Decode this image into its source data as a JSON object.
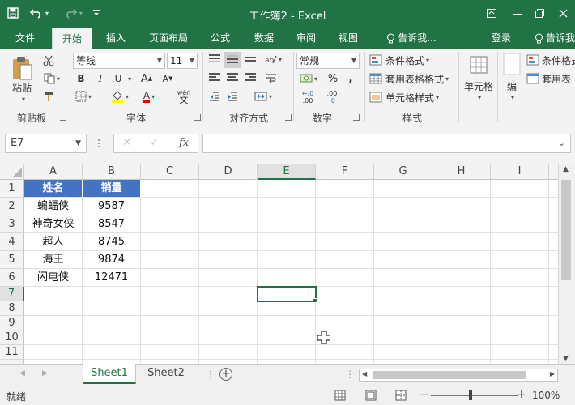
{
  "window": {
    "title": "工作簿2 - Excel"
  },
  "tabs": [
    {
      "label": "文件"
    },
    {
      "label": "开始"
    },
    {
      "label": "插入"
    },
    {
      "label": "页面布局"
    },
    {
      "label": "公式"
    },
    {
      "label": "数据"
    },
    {
      "label": "审阅"
    },
    {
      "label": "视图"
    },
    {
      "label": "告诉我..."
    },
    {
      "label": "登录"
    },
    {
      "label": "告诉我"
    }
  ],
  "ribbon": {
    "clipboard": {
      "paste": "粘贴",
      "group": "剪贴板"
    },
    "font": {
      "name": "等线",
      "size": "11",
      "group": "字体",
      "bold": "B",
      "italic": "I",
      "underline": "U",
      "grow": "A",
      "shrink": "A",
      "color_a": "A",
      "wen": "wén",
      "wen_char": "文"
    },
    "alignment": {
      "group": "对齐方式"
    },
    "number": {
      "format": "常规",
      "group": "数字",
      "percent": "%",
      "comma": ",",
      "inc_dec": ".00",
      "dec_dec": ".0"
    },
    "styles": {
      "conditional": "条件格式",
      "table": "套用表格格式",
      "cell_styles": "单元格样式",
      "group": "样式"
    },
    "cells": {
      "label": "单元格"
    },
    "editing": {
      "label": "编",
      "right1": "条件格式",
      "right2": "套用表"
    }
  },
  "formula_bar": {
    "name_box": "E7",
    "fx": "fx",
    "value": ""
  },
  "columns": [
    "A",
    "B",
    "C",
    "D",
    "E",
    "F",
    "G",
    "H",
    "I"
  ],
  "rows": [
    "1",
    "2",
    "3",
    "4",
    "5",
    "6",
    "7",
    "8",
    "9",
    "10",
    "11"
  ],
  "table": {
    "header": [
      "姓名",
      "销量"
    ],
    "rows": [
      [
        "蝙蝠侠",
        "9587"
      ],
      [
        "神奇女侠",
        "8547"
      ],
      [
        "超人",
        "8745"
      ],
      [
        "海王",
        "9874"
      ],
      [
        "闪电侠",
        "12471"
      ]
    ]
  },
  "sheets": [
    {
      "label": "Sheet1"
    },
    {
      "label": "Sheet2"
    }
  ],
  "status": {
    "ready": "就绪",
    "zoom": "100%"
  },
  "colors": {
    "excel_green": "#217346",
    "table_header": "#4472c4"
  }
}
